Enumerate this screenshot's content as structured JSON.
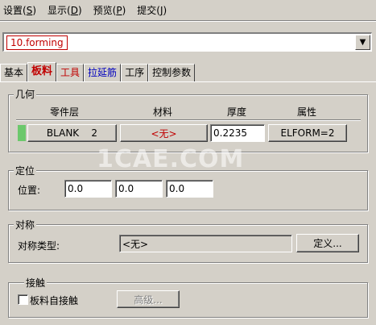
{
  "menu": [
    {
      "label": "设置(",
      "key": "S",
      "close": ")"
    },
    {
      "label": "显示(",
      "key": "D",
      "close": ")"
    },
    {
      "label": "预览(",
      "key": "P",
      "close": ")"
    },
    {
      "label": "提交(",
      "key": "J",
      "close": ")"
    }
  ],
  "dropdown": {
    "value": "10.forming",
    "arrow": "▼"
  },
  "tabs": [
    {
      "label": "基本"
    },
    {
      "label": "板料"
    },
    {
      "label": "工具"
    },
    {
      "label": "拉延筋"
    },
    {
      "label": "工序"
    },
    {
      "label": "控制参数"
    }
  ],
  "geometry": {
    "title": "几何",
    "headers": {
      "part": "零件层",
      "material": "材料",
      "thickness": "厚度",
      "property": "属性"
    },
    "part_value": "BLANK    2",
    "material_value": "<无>",
    "thickness_value": "0.2235",
    "property_value": "ELFORM=2"
  },
  "position": {
    "title": "定位",
    "label": "位置:",
    "x": "0.0",
    "y": "0.0",
    "z": "0.0"
  },
  "symmetry": {
    "title": "对称",
    "type_label": "对称类型:",
    "type_value": "<无>",
    "define_button": "定义..."
  },
  "contact": {
    "title": "接触",
    "self_contact_label": "板料自接触",
    "advanced_button": "高级..."
  },
  "watermark": "1CAE.COM",
  "colors": {
    "accent": "#c00000",
    "link": "#0000c0",
    "indicator": "#6cc86c"
  }
}
